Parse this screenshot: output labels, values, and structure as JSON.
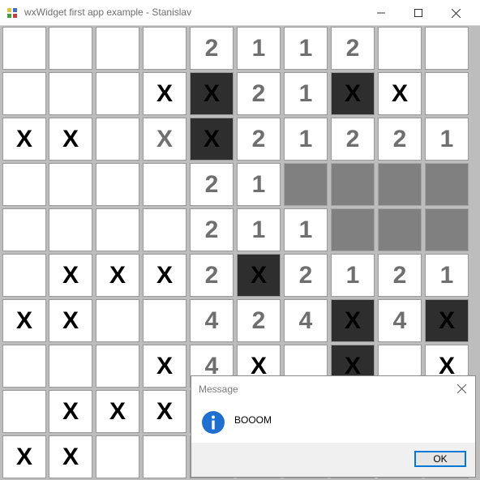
{
  "window": {
    "title": "wxWidget first app example - Stanislav"
  },
  "board": {
    "rows": [
      [
        {
          "t": "e"
        },
        {
          "t": "e"
        },
        {
          "t": "e"
        },
        {
          "t": "e"
        },
        {
          "t": "n",
          "v": "2"
        },
        {
          "t": "n",
          "v": "1"
        },
        {
          "t": "n",
          "v": "1"
        },
        {
          "t": "n",
          "v": "2"
        },
        {
          "t": "e"
        },
        {
          "t": "e"
        }
      ],
      [
        {
          "t": "e"
        },
        {
          "t": "e"
        },
        {
          "t": "e"
        },
        {
          "t": "x",
          "v": "X"
        },
        {
          "t": "m",
          "v": "X"
        },
        {
          "t": "n",
          "v": "2"
        },
        {
          "t": "n",
          "v": "1"
        },
        {
          "t": "m",
          "v": "X"
        },
        {
          "t": "x",
          "v": "X"
        },
        {
          "t": "e"
        }
      ],
      [
        {
          "t": "x",
          "v": "X"
        },
        {
          "t": "x",
          "v": "X"
        },
        {
          "t": "e"
        },
        {
          "t": "xg",
          "v": "X"
        },
        {
          "t": "m",
          "v": "X"
        },
        {
          "t": "n",
          "v": "2"
        },
        {
          "t": "n",
          "v": "1"
        },
        {
          "t": "n",
          "v": "2"
        },
        {
          "t": "n",
          "v": "2"
        },
        {
          "t": "n",
          "v": "1"
        }
      ],
      [
        {
          "t": "e"
        },
        {
          "t": "e"
        },
        {
          "t": "e"
        },
        {
          "t": "e"
        },
        {
          "t": "n",
          "v": "2"
        },
        {
          "t": "n",
          "v": "1"
        },
        {
          "t": "g"
        },
        {
          "t": "g"
        },
        {
          "t": "g"
        },
        {
          "t": "g"
        }
      ],
      [
        {
          "t": "e"
        },
        {
          "t": "e"
        },
        {
          "t": "e"
        },
        {
          "t": "e"
        },
        {
          "t": "n",
          "v": "2"
        },
        {
          "t": "n",
          "v": "1"
        },
        {
          "t": "n",
          "v": "1"
        },
        {
          "t": "g"
        },
        {
          "t": "g"
        },
        {
          "t": "g"
        }
      ],
      [
        {
          "t": "e"
        },
        {
          "t": "x",
          "v": "X"
        },
        {
          "t": "x",
          "v": "X"
        },
        {
          "t": "x",
          "v": "X"
        },
        {
          "t": "n",
          "v": "2"
        },
        {
          "t": "m",
          "v": "X"
        },
        {
          "t": "n",
          "v": "2"
        },
        {
          "t": "n",
          "v": "1"
        },
        {
          "t": "n",
          "v": "2"
        },
        {
          "t": "n",
          "v": "1"
        }
      ],
      [
        {
          "t": "x",
          "v": "X"
        },
        {
          "t": "x",
          "v": "X"
        },
        {
          "t": "e"
        },
        {
          "t": "e"
        },
        {
          "t": "n",
          "v": "4"
        },
        {
          "t": "n",
          "v": "2"
        },
        {
          "t": "n",
          "v": "4"
        },
        {
          "t": "m",
          "v": "X"
        },
        {
          "t": "n",
          "v": "4"
        },
        {
          "t": "m",
          "v": "X"
        }
      ],
      [
        {
          "t": "e"
        },
        {
          "t": "e"
        },
        {
          "t": "e"
        },
        {
          "t": "x",
          "v": "X"
        },
        {
          "t": "n",
          "v": "4"
        },
        {
          "t": "x",
          "v": "X"
        },
        {
          "t": "e"
        },
        {
          "t": "m",
          "v": "X"
        },
        {
          "t": "e"
        },
        {
          "t": "x",
          "v": "X"
        }
      ],
      [
        {
          "t": "e"
        },
        {
          "t": "x",
          "v": "X"
        },
        {
          "t": "x",
          "v": "X"
        },
        {
          "t": "x",
          "v": "X"
        },
        {
          "t": "e"
        },
        {
          "t": "e"
        },
        {
          "t": "e"
        },
        {
          "t": "e"
        },
        {
          "t": "e"
        },
        {
          "t": "e"
        }
      ],
      [
        {
          "t": "x",
          "v": "X"
        },
        {
          "t": "x",
          "v": "X"
        },
        {
          "t": "e"
        },
        {
          "t": "e"
        },
        {
          "t": "e"
        },
        {
          "t": "e"
        },
        {
          "t": "e"
        },
        {
          "t": "e"
        },
        {
          "t": "e"
        },
        {
          "t": "e"
        }
      ]
    ]
  },
  "dialog": {
    "title": "Message",
    "icon": "info-icon",
    "message": "BOOOM",
    "ok_label": "OK"
  },
  "colors": {
    "mine_bg": "#2e2e2e",
    "revealed_gray": "#808080",
    "number_text": "#6f6f6f",
    "accent": "#0078d7"
  }
}
